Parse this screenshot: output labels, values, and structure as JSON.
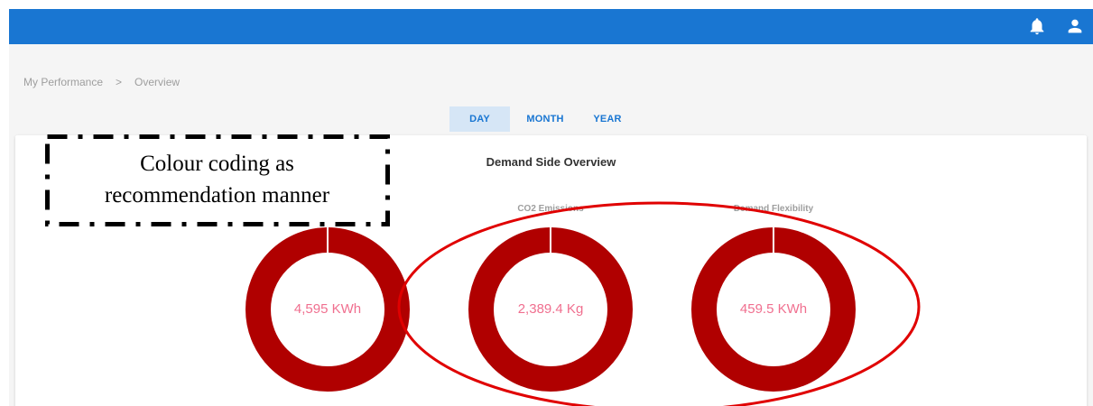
{
  "topbar": {
    "bell_icon": "bell-icon",
    "user_icon": "user-icon",
    "color": "#1976d2"
  },
  "breadcrumb": {
    "items": [
      "My Performance",
      "Overview"
    ],
    "separator": ">"
  },
  "tabs": [
    {
      "label": "DAY",
      "selected": true
    },
    {
      "label": "MONTH",
      "selected": false
    },
    {
      "label": "YEAR",
      "selected": false
    }
  ],
  "card": {
    "title": "Demand Side Overview"
  },
  "gauges": [
    {
      "label": "",
      "value": "4,595 KWh",
      "color": "#b00000"
    },
    {
      "label": "CO2 Emissions",
      "value": "2,389.4 Kg",
      "color": "#b00000"
    },
    {
      "label": "Demand Flexibility",
      "value": "459.5 KWh",
      "color": "#b00000"
    }
  ],
  "annotation": {
    "line1": "Colour coding as",
    "line2": "recommendation manner"
  },
  "colors": {
    "accent": "#1976d2",
    "gauge_fill": "#b00000",
    "gauge_value_text": "#f06f8f",
    "highlight_ellipse": "#e00000"
  }
}
